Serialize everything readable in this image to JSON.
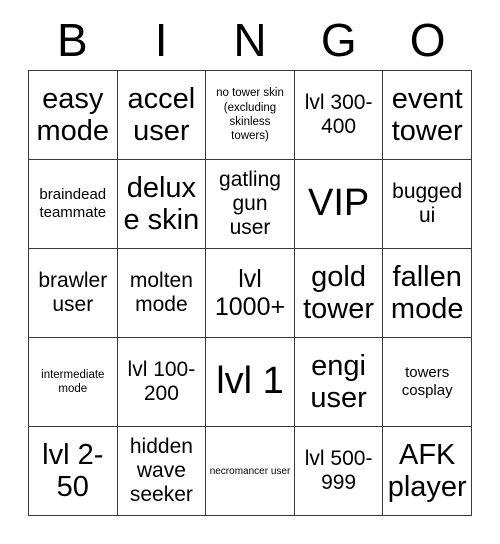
{
  "card": {
    "header_letters": [
      "B",
      "I",
      "N",
      "G",
      "O"
    ],
    "rows": [
      [
        {
          "text": "easy mode",
          "size": "fs-xl"
        },
        {
          "text": "accel user",
          "size": "fs-xl"
        },
        {
          "text": "no tower skin (excluding skinless towers)",
          "size": "fs-xs"
        },
        {
          "text": "lvl 300-400",
          "size": "fs-md"
        },
        {
          "text": "event tower",
          "size": "fs-xl"
        }
      ],
      [
        {
          "text": "braindead teammate",
          "size": "fs-sm"
        },
        {
          "text": "deluxe skin",
          "size": "fs-xl"
        },
        {
          "text": "gatling gun user",
          "size": "fs-md"
        },
        {
          "text": "VIP",
          "size": "fs-xxl"
        },
        {
          "text": "bugged ui",
          "size": "fs-md"
        }
      ],
      [
        {
          "text": "brawler user",
          "size": "fs-md"
        },
        {
          "text": "molten mode",
          "size": "fs-md"
        },
        {
          "text": "lvl 1000+",
          "size": "fs-lg"
        },
        {
          "text": "gold tower",
          "size": "fs-xl"
        },
        {
          "text": "fallen mode",
          "size": "fs-xl"
        }
      ],
      [
        {
          "text": "intermediate mode",
          "size": "fs-xs"
        },
        {
          "text": "lvl 100-200",
          "size": "fs-md"
        },
        {
          "text": "lvl 1",
          "size": "fs-xxl"
        },
        {
          "text": "engi user",
          "size": "fs-xl"
        },
        {
          "text": "towers cosplay",
          "size": "fs-sm"
        }
      ],
      [
        {
          "text": "lvl 2-50",
          "size": "fs-xl"
        },
        {
          "text": "hidden wave seeker",
          "size": "fs-md"
        },
        {
          "text": "necromancer user",
          "size": "fs-xxs"
        },
        {
          "text": "lvl 500-999",
          "size": "fs-md"
        },
        {
          "text": "AFK player",
          "size": "fs-xl"
        }
      ]
    ]
  }
}
